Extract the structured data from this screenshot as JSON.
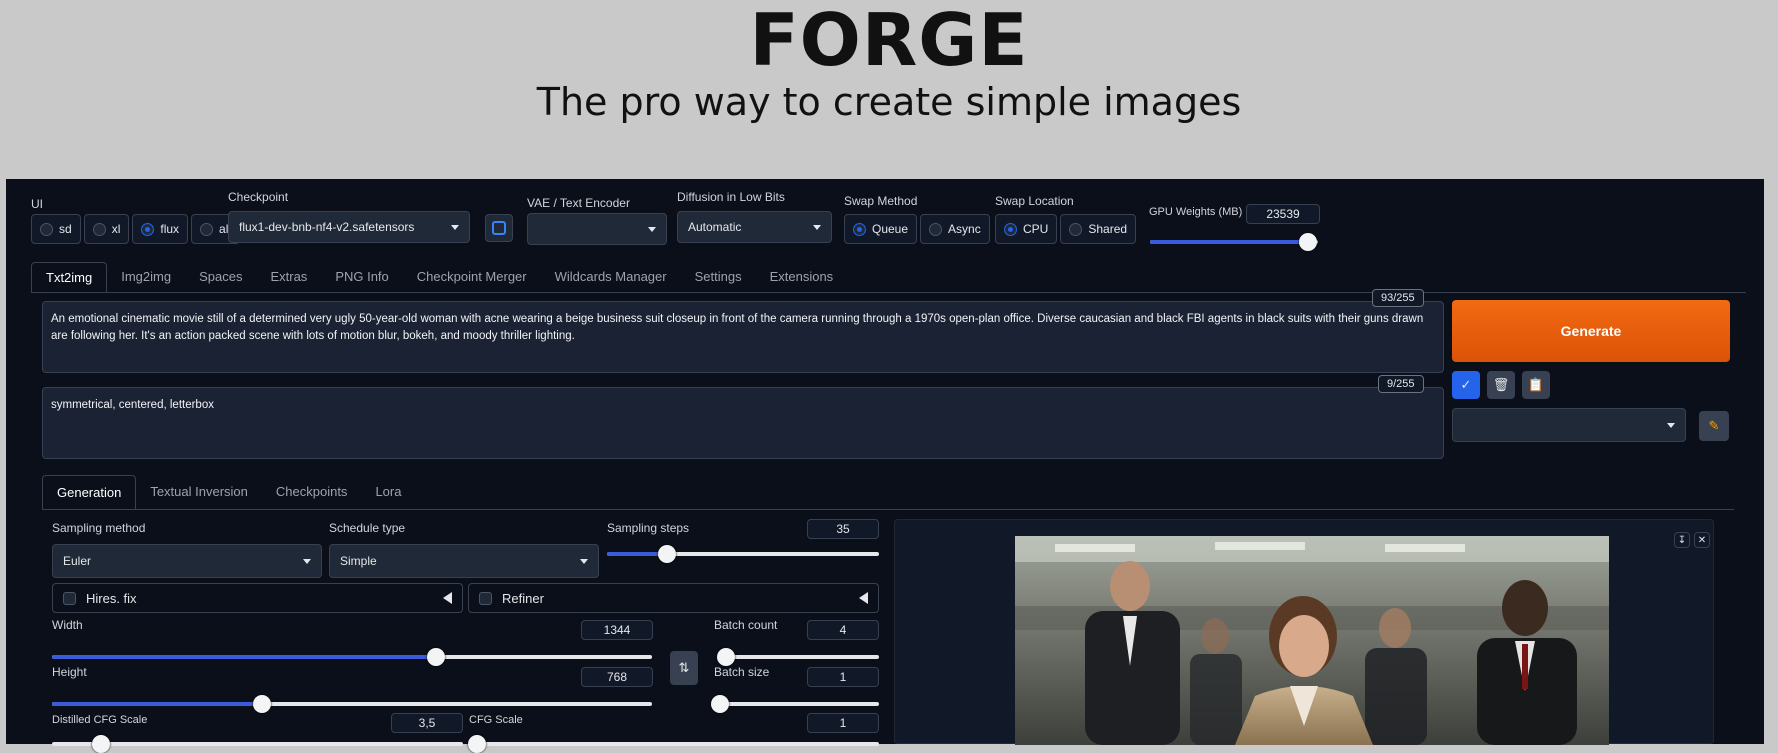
{
  "hero": {
    "title": "FORGE",
    "subtitle": "The pro way to create simple images"
  },
  "top": {
    "ui_label": "UI",
    "ui_options": [
      "sd",
      "xl",
      "flux",
      "all"
    ],
    "ui_selected": "flux",
    "checkpoint_label": "Checkpoint",
    "checkpoint_value": "flux1-dev-bnb-nf4-v2.safetensors",
    "vae_label": "VAE / Text Encoder",
    "vae_value": "",
    "diffusion_label": "Diffusion in Low Bits",
    "diffusion_value": "Automatic",
    "swap_method_label": "Swap Method",
    "swap_method_options": [
      "Queue",
      "Async"
    ],
    "swap_method_selected": "Queue",
    "swap_location_label": "Swap Location",
    "swap_location_options": [
      "CPU",
      "Shared"
    ],
    "swap_location_selected": "CPU",
    "gpu_label": "GPU Weights (MB)",
    "gpu_value": "23539",
    "gpu_fraction": 0.94
  },
  "main_tabs": [
    "Txt2img",
    "Img2img",
    "Spaces",
    "Extras",
    "PNG Info",
    "Checkpoint Merger",
    "Wildcards Manager",
    "Settings",
    "Extensions"
  ],
  "main_tab_active": "Txt2img",
  "prompt": {
    "text": "An emotional cinematic movie still of a determined very ugly 50-year-old woman with acne wearing a beige business suit closeup in front of the camera running through a 1970s open-plan office. Diverse caucasian and black FBI agents in black suits with their guns drawn are following her. It's an action packed scene with lots of motion blur, bokeh, and moody thriller lighting.",
    "counter": "93/255"
  },
  "negative": {
    "text": "symmetrical, centered, letterbox",
    "counter": "9/255"
  },
  "generate_label": "Generate",
  "sub_tabs": [
    "Generation",
    "Textual Inversion",
    "Checkpoints",
    "Lora"
  ],
  "sub_tab_active": "Generation",
  "gen": {
    "sampling_method_label": "Sampling method",
    "sampling_method_value": "Euler",
    "schedule_type_label": "Schedule type",
    "schedule_type_value": "Simple",
    "sampling_steps_label": "Sampling steps",
    "sampling_steps_value": "35",
    "hires_label": "Hires. fix",
    "refiner_label": "Refiner",
    "width_label": "Width",
    "width_value": "1344",
    "height_label": "Height",
    "height_value": "768",
    "batch_count_label": "Batch count",
    "batch_count_value": "4",
    "batch_size_label": "Batch size",
    "batch_size_value": "1",
    "distilled_cfg_label": "Distilled CFG Scale",
    "distilled_cfg_value": "3,5",
    "cfg_label": "CFG Scale",
    "cfg_value": "1"
  },
  "colors": {
    "accent": "#3b5bdb",
    "generate": "#ea5e0c",
    "bg": "#0b0f19"
  }
}
